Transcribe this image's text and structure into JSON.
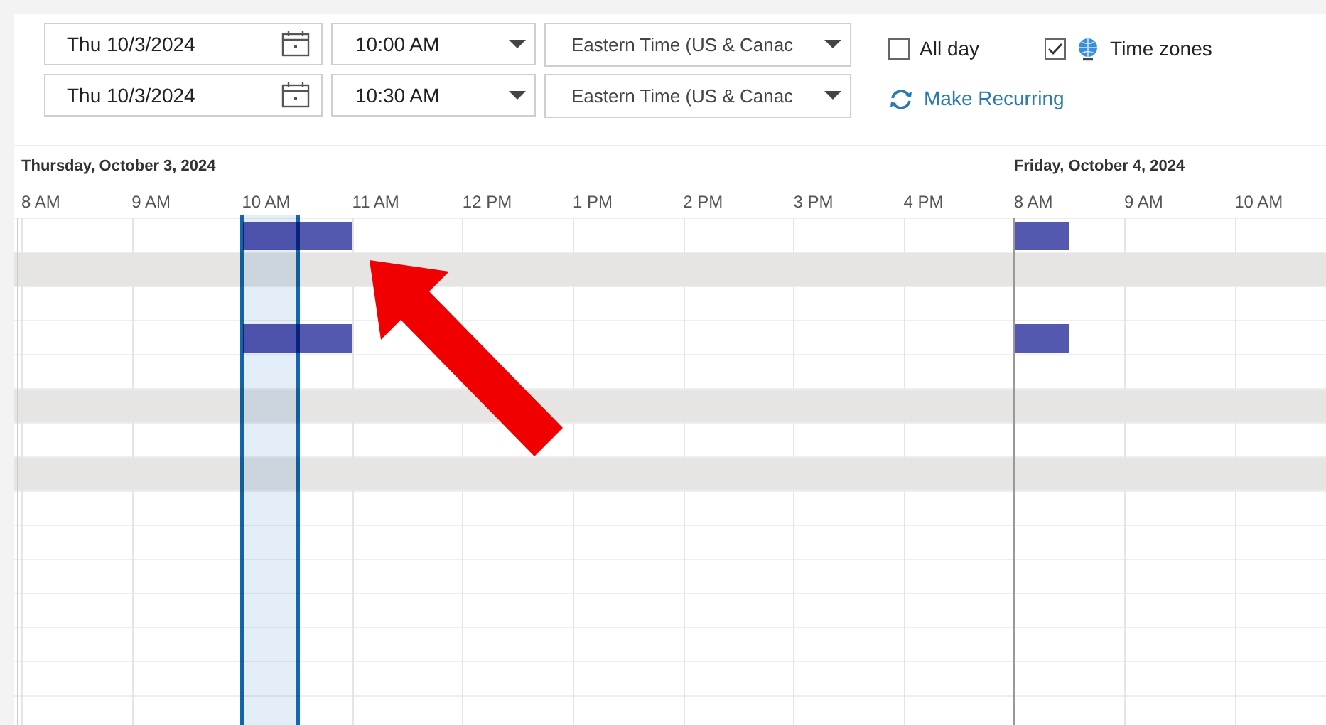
{
  "start": {
    "date": "Thu 10/3/2024",
    "time": "10:00 AM",
    "time_zone": "Eastern Time (US & Canac"
  },
  "end": {
    "date": "Thu 10/3/2024",
    "time": "10:30 AM",
    "time_zone": "Eastern Time (US & Canac"
  },
  "options": [
    {
      "label": "All day",
      "checked": false,
      "kind": "plain"
    },
    {
      "label": "Time zones",
      "checked": true,
      "kind": "globe"
    }
  ],
  "recurring_link": "Make Recurring",
  "days": [
    {
      "label": "Thursday, October 3, 2024",
      "hours": [
        {
          "label": "8 AM",
          "first_half_selected": false
        },
        {
          "label": "9 AM",
          "first_half_selected": false
        },
        {
          "label": "10 AM",
          "first_half_selected": true
        },
        {
          "label": "11 AM",
          "first_half_selected": false
        },
        {
          "label": "12 PM",
          "first_half_selected": false
        },
        {
          "label": "1 PM",
          "first_half_selected": false
        },
        {
          "label": "2 PM",
          "first_half_selected": false
        },
        {
          "label": "3 PM",
          "first_half_selected": false
        },
        {
          "label": "4 PM",
          "first_half_selected": false
        }
      ]
    },
    {
      "label": "Friday, October 4, 2024",
      "hours": [
        {
          "label": "8 AM",
          "first_half_selected": false
        },
        {
          "label": "9 AM",
          "first_half_selected": false
        },
        {
          "label": "10 AM",
          "first_half_selected": false
        }
      ]
    }
  ],
  "rows": [
    {
      "shaded": false,
      "cells": [
        {
          "kind": "free"
        },
        {
          "kind": "free"
        },
        {
          "kind": "busy"
        },
        {
          "kind": "free"
        },
        {
          "kind": "free"
        },
        {
          "kind": "free"
        },
        {
          "kind": "free"
        },
        {
          "kind": "free"
        },
        {
          "kind": "free"
        },
        {
          "kind": "busy_first_half"
        },
        {
          "kind": "free"
        },
        {
          "kind": "free"
        }
      ]
    },
    {
      "shaded": true
    },
    {
      "shaded": false
    },
    {
      "shaded": false,
      "cells": [
        {
          "kind": "free"
        },
        {
          "kind": "free"
        },
        {
          "kind": "busy"
        },
        {
          "kind": "free"
        },
        {
          "kind": "free"
        },
        {
          "kind": "free"
        },
        {
          "kind": "free"
        },
        {
          "kind": "free"
        },
        {
          "kind": "free"
        },
        {
          "kind": "busy_first_half"
        },
        {
          "kind": "free"
        },
        {
          "kind": "free"
        }
      ]
    },
    {
      "shaded": false
    },
    {
      "shaded": true
    },
    {
      "shaded": false
    },
    {
      "shaded": true
    },
    {
      "shaded": false
    },
    {
      "shaded": false
    },
    {
      "shaded": false
    },
    {
      "shaded": false
    },
    {
      "shaded": false
    },
    {
      "shaded": false
    },
    {
      "shaded": false
    }
  ]
}
